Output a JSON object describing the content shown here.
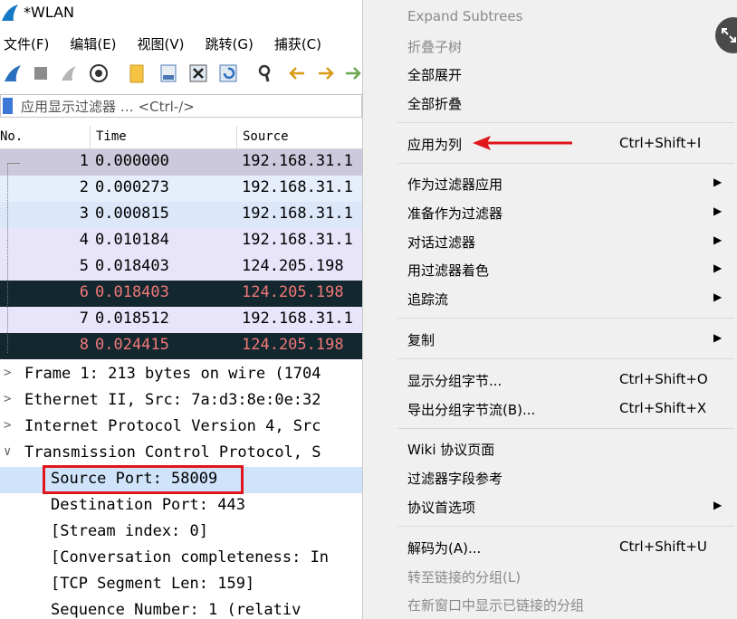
{
  "window": {
    "title": "*WLAN"
  },
  "menubar": [
    {
      "label": "文件(F)"
    },
    {
      "label": "编辑(E)"
    },
    {
      "label": "视图(V)"
    },
    {
      "label": "跳转(G)"
    },
    {
      "label": "捕获(C)"
    }
  ],
  "toolbar": {
    "icons": [
      "shark-fin-start-icon",
      "stop-square-icon",
      "restart-fin-icon",
      "options-gear-icon",
      "open-folder-icon",
      "save-file-icon",
      "close-file-icon",
      "reload-icon",
      "find-magnifier-icon",
      "back-arrow-icon",
      "forward-arrow-icon",
      "go-to-packet-icon"
    ]
  },
  "filter": {
    "placeholder": "应用显示过滤器 … <Ctrl-/>"
  },
  "packet_list": {
    "columns": [
      "No.",
      "Time",
      "Source"
    ],
    "rows": [
      {
        "no": "1",
        "time": "0.000000",
        "source": "192.168.31.1",
        "style": "sel"
      },
      {
        "no": "2",
        "time": "0.000273",
        "source": "192.168.31.1",
        "style": "tcp"
      },
      {
        "no": "3",
        "time": "0.000815",
        "source": "192.168.31.1",
        "style": "tcp2"
      },
      {
        "no": "4",
        "time": "0.010184",
        "source": "192.168.31.1",
        "style": "lav"
      },
      {
        "no": "5",
        "time": "0.018403",
        "source": "124.205.198",
        "style": "lav"
      },
      {
        "no": "6",
        "time": "0.018403",
        "source": "124.205.198",
        "style": "dark"
      },
      {
        "no": "7",
        "time": "0.018512",
        "source": "192.168.31.1",
        "style": "lav"
      },
      {
        "no": "8",
        "time": "0.024415",
        "source": "124.205.198",
        "style": "dark"
      }
    ]
  },
  "details": [
    {
      "arrow": ">",
      "text": "Frame 1: 213 bytes on wire (1704",
      "level": 0
    },
    {
      "arrow": ">",
      "text": "Ethernet II, Src: 7a:d3:8e:0e:32",
      "level": 0
    },
    {
      "arrow": ">",
      "text": "Internet Protocol Version 4, Src",
      "level": 0
    },
    {
      "arrow": "∨",
      "text": "Transmission Control Protocol, S",
      "level": 0
    },
    {
      "arrow": "",
      "text": "Source Port: 58009",
      "level": 1,
      "highlight": true
    },
    {
      "arrow": "",
      "text": "Destination Port: 443",
      "level": 1
    },
    {
      "arrow": "",
      "text": "[Stream index: 0]",
      "level": 1
    },
    {
      "arrow": "",
      "text": "[Conversation completeness: In",
      "level": 1
    },
    {
      "arrow": "",
      "text": "[TCP Segment Len: 159]",
      "level": 1
    },
    {
      "arrow": "",
      "text": "Sequence Number: 1    (relativ",
      "level": 1
    }
  ],
  "context_menu": {
    "items": [
      {
        "label": "Expand Subtrees",
        "disabled": true
      },
      {
        "label": "折叠子树",
        "disabled": true
      },
      {
        "label": "全部展开"
      },
      {
        "label": "全部折叠"
      },
      {
        "label": "应用为列",
        "shortcut": "Ctrl+Shift+I"
      },
      {
        "label": "作为过滤器应用",
        "submenu": true
      },
      {
        "label": "准备作为过滤器",
        "submenu": true
      },
      {
        "label": "对话过滤器",
        "submenu": true
      },
      {
        "label": "用过滤器着色",
        "submenu": true
      },
      {
        "label": "追踪流",
        "submenu": true
      },
      {
        "label": "复制",
        "submenu": true
      },
      {
        "label": "显示分组字节...",
        "shortcut": "Ctrl+Shift+O"
      },
      {
        "label": "导出分组字节流(B)...",
        "shortcut": "Ctrl+Shift+X"
      },
      {
        "label": "Wiki 协议页面"
      },
      {
        "label": "过滤器字段参考"
      },
      {
        "label": "协议首选项",
        "submenu": true
      },
      {
        "label": "解码为(A)...",
        "shortcut": "Ctrl+Shift+U"
      },
      {
        "label": "转至链接的分组(L)",
        "disabled": true
      },
      {
        "label": "在新窗口中显示已链接的分组",
        "disabled": true
      }
    ],
    "submenu_glyph": "▶"
  },
  "annotations": {
    "highlight_color": "#e0161b"
  }
}
